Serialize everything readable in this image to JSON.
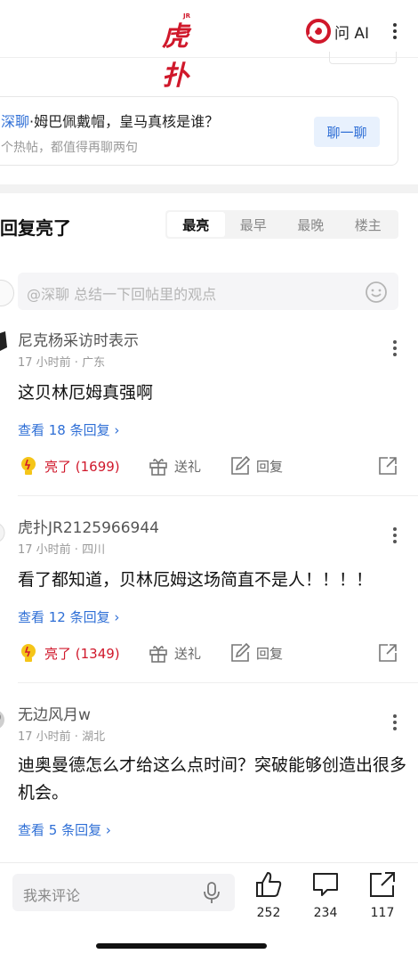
{
  "header": {
    "logo_text": "虎扑",
    "logo_sub": "JR",
    "ai_label": "问 AI"
  },
  "banner": {
    "brand": "深聊",
    "title_rest": "·姆巴佩戴帽，皇马真核是谁？",
    "subtitle": "个热帖，都值得再聊两句",
    "button": "聊一聊"
  },
  "section": {
    "title": "回复亮了",
    "tabs": [
      "最亮",
      "最早",
      "最晚",
      "楼主"
    ],
    "active_tab": "最亮"
  },
  "summary": {
    "placeholder": "@深聊 总结一下回帖里的观点"
  },
  "comments": [
    {
      "user": "尼克杨采访时表示",
      "time": "17 小时前",
      "location": "广东",
      "meta": "17 小时前 · 广东",
      "text": "这贝林厄姆真强啊",
      "replies": "查看 18 条回复 ›",
      "likes": "亮了 (1699)",
      "gift": "送礼",
      "reply": "回复"
    },
    {
      "user": "虎扑JR2125966944",
      "time": "17 小时前",
      "location": "四川",
      "meta": "17 小时前 · 四川",
      "text": "看了都知道，贝林厄姆这场简直不是人！！！！",
      "replies": "查看 12 条回复 ›",
      "likes": "亮了 (1349)",
      "gift": "送礼",
      "reply": "回复"
    },
    {
      "user": "无边风月w",
      "time": "17 小时前",
      "location": "湖北",
      "meta": "17 小时前 · 湖北",
      "text": "迪奥曼德怎么才给这么点时间？突破能够创造出很多机会。",
      "replies": "查看 5 条回复 ›"
    }
  ],
  "bottom_bar": {
    "comment_placeholder": "我来评论",
    "likes_count": "252",
    "comments_count": "234",
    "shares_count": "117"
  },
  "colors": {
    "brand_red": "#d0182b",
    "link_blue": "#2f6fd6"
  }
}
